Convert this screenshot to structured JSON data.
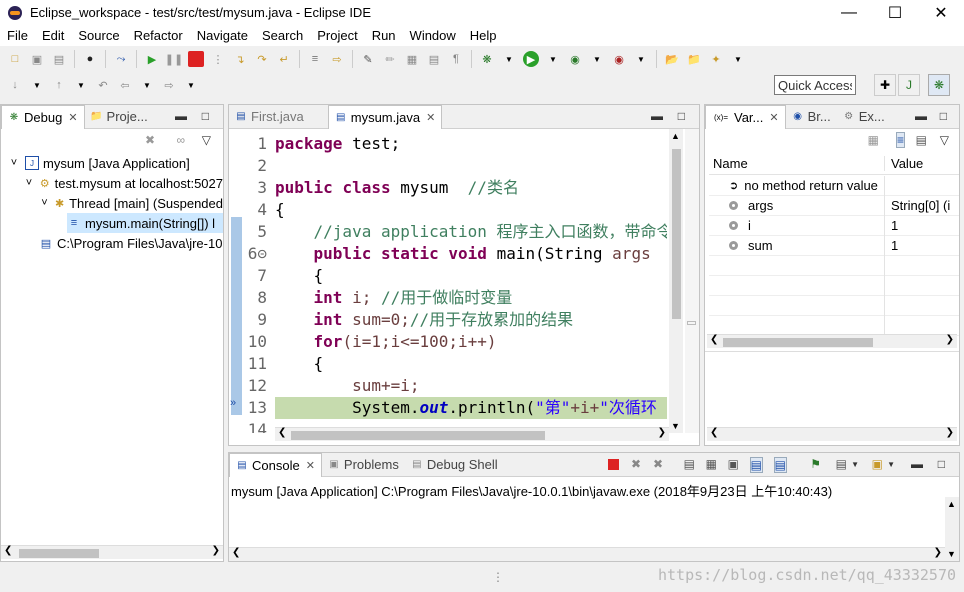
{
  "window": {
    "title": "Eclipse_workspace - test/src/test/mysum.java - Eclipse IDE"
  },
  "menu": [
    "File",
    "Edit",
    "Source",
    "Refactor",
    "Navigate",
    "Search",
    "Project",
    "Run",
    "Window",
    "Help"
  ],
  "quick_access": "Quick Access",
  "debug_view": {
    "tabs": [
      {
        "label": "Debug"
      },
      {
        "label": "Proje..."
      }
    ],
    "tree": [
      {
        "label": "mysum [Java Application]",
        "icon": "java-app-icon"
      },
      {
        "label": "test.mysum at localhost:5027",
        "icon": "debug-target-icon"
      },
      {
        "label": "Thread [main] (Suspended",
        "icon": "thread-icon"
      },
      {
        "label": "mysum.main(String[]) l",
        "icon": "stack-frame-icon"
      },
      {
        "label": "C:\\Program Files\\Java\\jre-10",
        "icon": "process-icon"
      }
    ]
  },
  "editor": {
    "tabs": [
      {
        "label": "First.java"
      },
      {
        "label": "mysum.java"
      }
    ],
    "line_numbers": [
      "1",
      "2",
      "3",
      "4",
      "5",
      "6⊝",
      "7",
      "8",
      "9",
      "10",
      "11",
      "12",
      "13",
      "14"
    ],
    "code": {
      "l1_kw": "package",
      "l1_rest": " test;",
      "l3_kw1": "public",
      "l3_kw2": "class",
      "l3_name": " mysum  ",
      "l3_cm": "//类名",
      "l4": "{",
      "l5_cm": "//java application 程序主入口函数，带命令",
      "l6_kw1": "public",
      "l6_kw2": "static",
      "l6_kw3": "void",
      "l6_rest": " main(String ",
      "l6_param": "args",
      "l7": "{",
      "l8_kw": "int",
      "l8_rest": " i; ",
      "l8_cm": "//用于做临时变量",
      "l9_kw": "int",
      "l9_rest": " sum=0;",
      "l9_cm": "//用于存放累加的结果",
      "l10_kw": "for",
      "l10_rest": "(i=1;i<=100;i++)",
      "l11": "{",
      "l12": "sum+=i;",
      "l13_pre": "System.",
      "l13_out": "out",
      "l13_mid": ".println(",
      "l13_s1": "\"第\"",
      "l13_plus": "+i+",
      "l13_s2": "\"次循环"
    }
  },
  "variables": {
    "tabs": [
      {
        "label": "Var..."
      },
      {
        "label": "Br..."
      },
      {
        "label": "Ex..."
      }
    ],
    "columns": [
      "Name",
      "Value"
    ],
    "rows": [
      {
        "name": "no method return value",
        "value": ""
      },
      {
        "name": "args",
        "value": "String[0]  (i"
      },
      {
        "name": "i",
        "value": "1"
      },
      {
        "name": "sum",
        "value": "1"
      }
    ]
  },
  "console": {
    "tabs": [
      {
        "label": "Console"
      },
      {
        "label": "Problems"
      },
      {
        "label": "Debug Shell"
      }
    ],
    "header": "mysum [Java Application] C:\\Program Files\\Java\\jre-10.0.1\\bin\\javaw.exe (2018年9月23日 上午10:40:43)"
  },
  "watermark": "https://blog.csdn.net/qq_43332570"
}
